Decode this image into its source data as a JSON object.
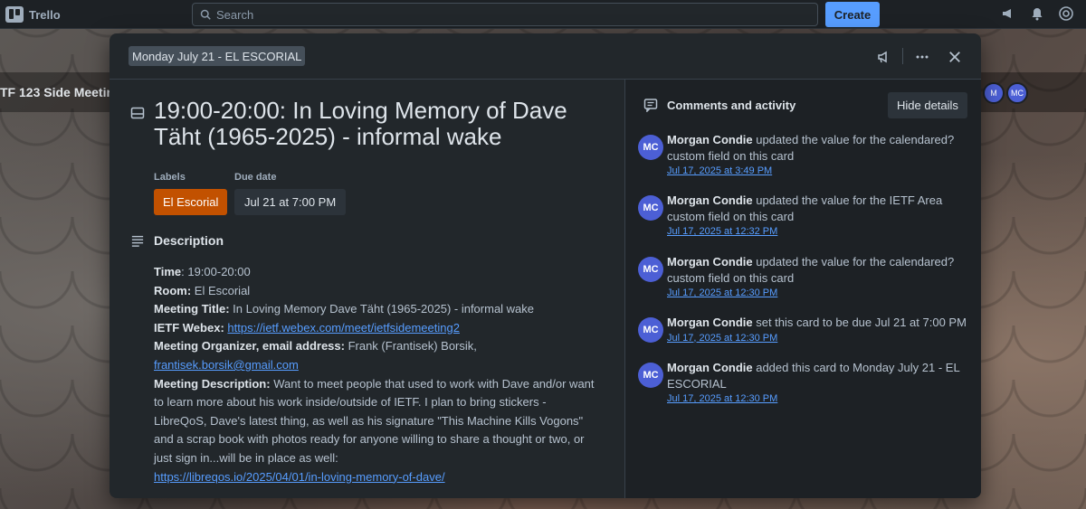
{
  "topbar": {
    "app_name": "Trello",
    "search_placeholder": "Search",
    "create_label": "Create"
  },
  "board": {
    "title": "TF 123 Side Meetin",
    "avatar_initials": [
      "M",
      "MC"
    ]
  },
  "modal": {
    "list_name": "Monday July 21 - EL ESCORIAL",
    "card_title": "19:00-20:00: In Loving Memory of Dave Täht (1965-2025) - informal wake",
    "labels_heading": "Labels",
    "due_date_heading": "Due date",
    "label_name": "El Escorial",
    "due_date": "Jul 21 at 7:00 PM",
    "description_heading": "Description",
    "description": {
      "time_label": "Time",
      "time_value": ": 19:00-20:00",
      "room_label": "Room:",
      "room_value": " El Escorial",
      "meeting_title_label": "Meeting Title:",
      "meeting_title_value": " In Loving Memory Dave Täht (1965-2025) - informal wake",
      "webex_label": "IETF Webex:",
      "webex_link": "https://ietf.webex.com/meet/ietfsidemeeting2",
      "organizer_label": "Meeting Organizer, email address:",
      "organizer_value": " Frank (Frantisek) Borsik,",
      "organizer_email": "frantisek.borsik@gmail.com",
      "meeting_desc_label": "Meeting Description:",
      "meeting_desc_value": " Want to meet people that used to work with Dave and/or want to learn more about his work inside/outside of IETF. I plan to bring stickers - LibreQoS, Dave's latest thing, as well as his signature \"This Machine Kills Vogons\" and a scrap book with photos ready for anyone willing to share a thought or two, or just sign in...will be in place as well:",
      "memorial_link": "https://libreqos.io/2025/04/01/in-loving-memory-of-dave/"
    }
  },
  "activity": {
    "heading": "Comments and activity",
    "hide_details_label": "Hide details",
    "items": [
      {
        "initials": "MC",
        "user": "Morgan Condie",
        "action": " updated the value for the calendared? custom field on this card",
        "time": "Jul 17, 2025 at 3:49 PM"
      },
      {
        "initials": "MC",
        "user": "Morgan Condie",
        "action": " updated the value for the IETF Area custom field on this card",
        "time": "Jul 17, 2025 at 12:32 PM"
      },
      {
        "initials": "MC",
        "user": "Morgan Condie",
        "action": " updated the value for the calendared? custom field on this card",
        "time": "Jul 17, 2025 at 12:30 PM"
      },
      {
        "initials": "MC",
        "user": "Morgan Condie",
        "action": " set this card to be due Jul 21 at 7:00 PM",
        "time": "Jul 17, 2025 at 12:30 PM"
      },
      {
        "initials": "MC",
        "user": "Morgan Condie",
        "action": " added this card to Monday July 21 - EL ESCORIAL",
        "time": "Jul 17, 2025 at 12:30 PM"
      }
    ]
  },
  "colors": {
    "accent": "#579dff",
    "label_orange": "#c25100",
    "avatar": "#4c5fd5",
    "modal_bg": "#22272b"
  }
}
